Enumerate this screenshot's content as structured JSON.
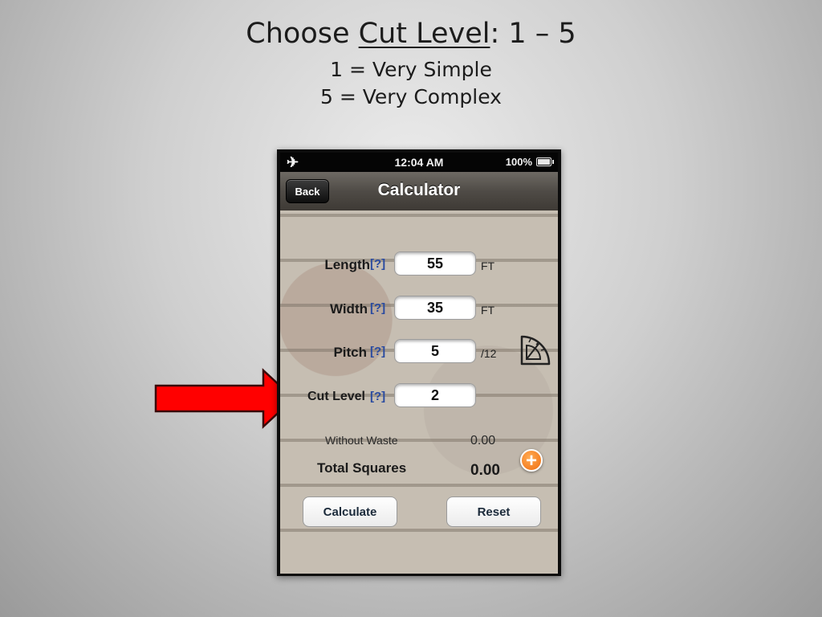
{
  "slide": {
    "title_prefix": "Choose ",
    "title_underlined": "Cut Level",
    "title_suffix": ": 1 – 5",
    "subtitle_1": "1 = Very Simple",
    "subtitle_2": "5 = Very Complex",
    "arrow_color": "#ff0000"
  },
  "status_bar": {
    "mode_icon": "airplane-icon",
    "airplane_glyph": "✈",
    "time": "12:04 AM",
    "battery": "100%"
  },
  "nav": {
    "back_label": "Back",
    "title": "Calculator"
  },
  "fields": [
    {
      "label": "Length",
      "help": "[?]",
      "value": "55",
      "unit": "FT"
    },
    {
      "label": "Width",
      "help": "[?]",
      "value": "35",
      "unit": "FT"
    },
    {
      "label": "Pitch",
      "help": "[?]",
      "value": "5",
      "unit": "/12"
    },
    {
      "label": "Cut Level",
      "help": "[?]",
      "value": "2",
      "unit": ""
    }
  ],
  "results": {
    "without_waste_label": "Without Waste",
    "without_waste_value": "0.00",
    "total_squares_label": "Total Squares",
    "total_squares_value": "0.00"
  },
  "buttons": {
    "plus_glyph": "+",
    "calculate_label": "Calculate",
    "reset_label": "Reset"
  },
  "colors": {
    "help_link": "#2a4ba0",
    "plus_button": "#f07a1a"
  }
}
